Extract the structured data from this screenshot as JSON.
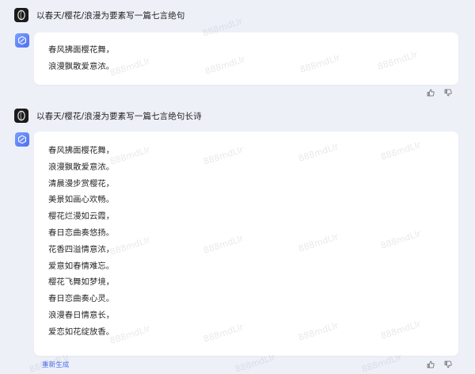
{
  "conversation": [
    {
      "user_prompt": "以春天/樱花/浪漫为要素写一篇七言绝句",
      "response_lines": [
        "春风拂面樱花舞，",
        "浪漫飘散爱意浓。"
      ]
    },
    {
      "user_prompt": "以春天/樱花/浪漫为要素写一篇七言绝句长诗",
      "response_lines": [
        "春风拂面樱花舞，",
        "浪漫飘散爱意浓。",
        "清晨漫步赏樱花，",
        "美景如画心欢畅。",
        "樱花烂漫如云霞，",
        "春日恋曲奏悠扬。",
        "花香四溢情意浓，",
        "爱意如春情难忘。",
        "樱花飞舞如梦境，",
        "春日恋曲奏心灵。",
        "浪漫春日情意长，",
        "爱恋如花绽放香。"
      ]
    }
  ],
  "footer": {
    "regenerate_label": "重新生成"
  },
  "watermark": "888mdLlr",
  "icons": {
    "user_avatar": "user-avatar-icon",
    "bot_avatar": "cube-logo-icon",
    "like": "thumbs-up-icon",
    "dislike": "thumbs-down-icon"
  },
  "colors": {
    "accent": "#4a6cf0",
    "background": "#eef0f8",
    "card": "#ffffff"
  }
}
